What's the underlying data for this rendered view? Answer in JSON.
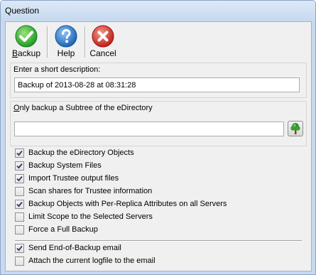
{
  "window": {
    "title": "Question"
  },
  "toolbar": {
    "backup": {
      "label": "Backup",
      "icon": "check-icon",
      "color": "#2eae2e"
    },
    "help": {
      "label": "Help",
      "icon": "help-icon",
      "color": "#2f7fd0"
    },
    "cancel": {
      "label": "Cancel",
      "icon": "cancel-icon",
      "color": "#d9342b"
    }
  },
  "description": {
    "label": "Enter a short description:",
    "value": "Backup of 2013-08-28 at 08:31:28"
  },
  "subtree": {
    "label": "Only backup a Subtree of the eDirectory",
    "value": "",
    "browse_icon": "tree-icon"
  },
  "options": [
    {
      "label": "Backup the eDirectory Objects",
      "checked": true
    },
    {
      "label": "Backup System Files",
      "checked": true
    },
    {
      "label": "Import Trustee output files",
      "checked": true
    },
    {
      "label": "Scan shares for Trustee information",
      "checked": false
    },
    {
      "label": "Backup Objects with Per-Replica Attributes on all Servers",
      "checked": true
    },
    {
      "label": "Limit Scope to the Selected Servers",
      "checked": false
    },
    {
      "label": "Force a Full Backup",
      "checked": false
    }
  ],
  "email_options": [
    {
      "label": "Send End-of-Backup email",
      "checked": true
    },
    {
      "label": "Attach the current logfile to the email",
      "checked": false
    }
  ]
}
